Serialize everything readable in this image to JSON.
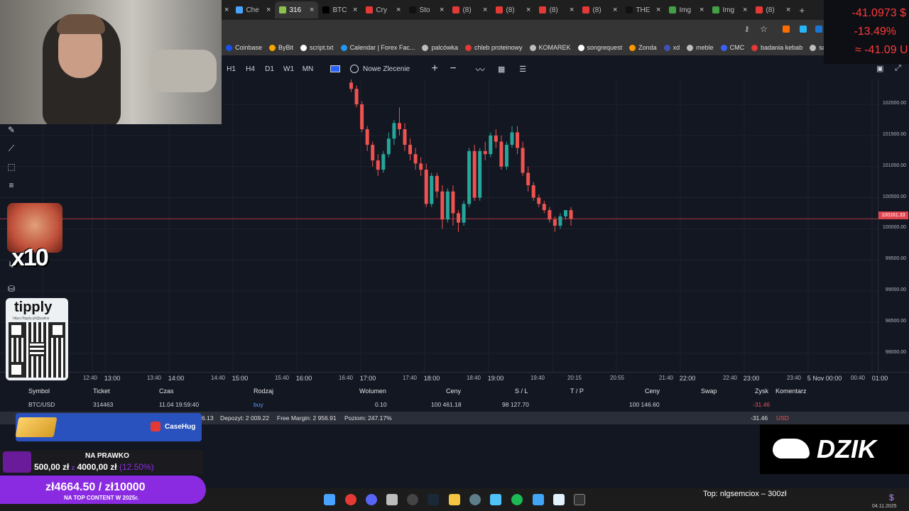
{
  "browser": {
    "tabs": [
      {
        "label": "Che",
        "color": "#4aa3ff",
        "active": false
      },
      {
        "label": "316",
        "color": "#8bc34a",
        "active": true
      },
      {
        "label": "BTC",
        "color": "#000000",
        "active": false
      },
      {
        "label": "Cry",
        "color": "#e53935",
        "active": false
      },
      {
        "label": "Sto",
        "color": "#111111",
        "active": false
      },
      {
        "label": "(8)",
        "color": "#e53935",
        "active": false
      },
      {
        "label": "(8)",
        "color": "#e53935",
        "active": false
      },
      {
        "label": "(8)",
        "color": "#e53935",
        "active": false
      },
      {
        "label": "(8)",
        "color": "#e53935",
        "active": false
      },
      {
        "label": "THE",
        "color": "#111111",
        "active": false
      },
      {
        "label": "Img",
        "color": "#43a047",
        "active": false
      },
      {
        "label": "Img",
        "color": "#43a047",
        "active": false
      },
      {
        "label": "(8)",
        "color": "#e53935",
        "active": false
      }
    ],
    "new_tab": "+",
    "bookmarks": [
      {
        "label": "Coinbase",
        "color": "#1652f0"
      },
      {
        "label": "ByBit",
        "color": "#f7a600"
      },
      {
        "label": "script.txt",
        "color": "#ffffff"
      },
      {
        "label": "Calendar | Forex Fac...",
        "color": "#2196f3"
      },
      {
        "label": "palcówka",
        "color": "#bdbdbd"
      },
      {
        "label": "chleb proteinowy",
        "color": "#e53935"
      },
      {
        "label": "KOMAREK",
        "color": "#bdbdbd"
      },
      {
        "label": "songrequest",
        "color": "#ffffff"
      },
      {
        "label": "Zonda",
        "color": "#ff9800"
      },
      {
        "label": "xd",
        "color": "#3f51b5"
      },
      {
        "label": "meble",
        "color": "#bdbdbd"
      },
      {
        "label": "CMC",
        "color": "#3861fb"
      },
      {
        "label": "badania kebab",
        "color": "#e53935"
      },
      {
        "label": "sauna",
        "color": "#bdbdbd"
      }
    ]
  },
  "toolbar": {
    "timeframes": [
      "H1",
      "H4",
      "D1",
      "W1",
      "MN"
    ],
    "new_order": "Nowe Zlecenie",
    "plus": "+",
    "minus": "−"
  },
  "chart_data": {
    "type": "candlestick",
    "symbol": "BTC/USD",
    "ylim": [
      97700,
      102400
    ],
    "y_ticks": [
      102000,
      101500,
      101000,
      100500,
      100000,
      99500,
      99000,
      98500,
      98000
    ],
    "y_tick_labels": [
      "102000.00",
      "101500.00",
      "101000.00",
      "100500.00",
      "100000.00",
      "99500.00",
      "99000.00",
      "98500.00",
      "98000.00"
    ],
    "current_price": 100161.33,
    "current_price_label": "100161.33",
    "candles": [
      {
        "o": 102350,
        "h": 102420,
        "c": 102250,
        "l": 102200
      },
      {
        "o": 102250,
        "h": 102300,
        "c": 102000,
        "l": 101950
      },
      {
        "o": 102000,
        "h": 102050,
        "c": 101600,
        "l": 101550
      },
      {
        "o": 101600,
        "h": 101650,
        "c": 101350,
        "l": 101250
      },
      {
        "o": 101350,
        "h": 101400,
        "c": 101100,
        "l": 101000
      },
      {
        "o": 101100,
        "h": 101200,
        "c": 100950,
        "l": 100850
      },
      {
        "o": 100950,
        "h": 101250,
        "c": 101200,
        "l": 100900
      },
      {
        "o": 101200,
        "h": 101550,
        "c": 101450,
        "l": 101150
      },
      {
        "o": 101450,
        "h": 101750,
        "c": 101700,
        "l": 101350
      },
      {
        "o": 101700,
        "h": 101950,
        "c": 101600,
        "l": 101500
      },
      {
        "o": 101600,
        "h": 101700,
        "c": 101350,
        "l": 101250
      },
      {
        "o": 101350,
        "h": 101450,
        "c": 101200,
        "l": 101100
      },
      {
        "o": 101200,
        "h": 101300,
        "c": 101050,
        "l": 100950
      },
      {
        "o": 101050,
        "h": 101150,
        "c": 100950,
        "l": 100850
      },
      {
        "o": 100950,
        "h": 101050,
        "c": 100400,
        "l": 100350
      },
      {
        "o": 100400,
        "h": 100900,
        "c": 100850,
        "l": 100350
      },
      {
        "o": 100850,
        "h": 100900,
        "c": 100600,
        "l": 100500
      },
      {
        "o": 100600,
        "h": 100700,
        "c": 100150,
        "l": 100000
      },
      {
        "o": 100150,
        "h": 100650,
        "c": 100600,
        "l": 100100
      },
      {
        "o": 100600,
        "h": 100700,
        "c": 100250,
        "l": 100050
      },
      {
        "o": 100250,
        "h": 100300,
        "c": 100100,
        "l": 99950
      },
      {
        "o": 100100,
        "h": 100450,
        "c": 100400,
        "l": 100050
      },
      {
        "o": 100400,
        "h": 101300,
        "c": 101250,
        "l": 100350
      },
      {
        "o": 101250,
        "h": 101350,
        "c": 100500,
        "l": 100450
      },
      {
        "o": 100500,
        "h": 101300,
        "c": 101250,
        "l": 100450
      },
      {
        "o": 101250,
        "h": 101400,
        "c": 101200,
        "l": 101100
      },
      {
        "o": 101200,
        "h": 101550,
        "c": 101500,
        "l": 101150
      },
      {
        "o": 101500,
        "h": 101600,
        "c": 101400,
        "l": 101300
      },
      {
        "o": 101400,
        "h": 101500,
        "c": 101000,
        "l": 100950
      },
      {
        "o": 101000,
        "h": 101400,
        "c": 101350,
        "l": 100950
      },
      {
        "o": 101350,
        "h": 101650,
        "c": 101550,
        "l": 101300
      },
      {
        "o": 101550,
        "h": 101650,
        "c": 101300,
        "l": 101200
      },
      {
        "o": 101300,
        "h": 101400,
        "c": 100900,
        "l": 100850
      },
      {
        "o": 100900,
        "h": 101000,
        "c": 100700,
        "l": 100600
      },
      {
        "o": 100700,
        "h": 100750,
        "c": 100500,
        "l": 100450
      },
      {
        "o": 100500,
        "h": 100550,
        "c": 100400,
        "l": 100350
      },
      {
        "o": 100400,
        "h": 100450,
        "c": 100300,
        "l": 100250
      },
      {
        "o": 100300,
        "h": 100350,
        "c": 100150,
        "l": 100100
      },
      {
        "o": 100150,
        "h": 100200,
        "c": 100050,
        "l": 99950
      },
      {
        "o": 100050,
        "h": 100250,
        "c": 100200,
        "l": 100000
      },
      {
        "o": 100200,
        "h": 100300,
        "c": 100300,
        "l": 100150
      },
      {
        "o": 100300,
        "h": 100350,
        "c": 100160,
        "l": 100050
      }
    ],
    "x_ticks": [
      {
        "label": "12:40",
        "major": false
      },
      {
        "label": "13:00",
        "major": true
      },
      {
        "label": "13:40",
        "major": false
      },
      {
        "label": "14:00",
        "major": true
      },
      {
        "label": "14:40",
        "major": false
      },
      {
        "label": "15:00",
        "major": true
      },
      {
        "label": "15:40",
        "major": false
      },
      {
        "label": "16:00",
        "major": true
      },
      {
        "label": "16:40",
        "major": false
      },
      {
        "label": "17:00",
        "major": true
      },
      {
        "label": "17:40",
        "major": false
      },
      {
        "label": "18:00",
        "major": true
      },
      {
        "label": "18:40",
        "major": false
      },
      {
        "label": "19:00",
        "major": true
      },
      {
        "label": "19:40",
        "major": false
      },
      {
        "label": "20:15",
        "major": false
      },
      {
        "label": "20:55",
        "major": false
      },
      {
        "label": "21:40",
        "major": false
      },
      {
        "label": "22:00",
        "major": true
      },
      {
        "label": "22:40",
        "major": false
      },
      {
        "label": "23:00",
        "major": true
      },
      {
        "label": "23:40",
        "major": false
      },
      {
        "label": "5 Nov 00:00",
        "major": true
      },
      {
        "label": "00:40",
        "major": false
      },
      {
        "label": "01:00",
        "major": true
      }
    ],
    "colors": {
      "up": "#26a69a",
      "down": "#ef5350",
      "price_line": "#e0444f"
    },
    "grid": true
  },
  "orders": {
    "headers": [
      "Symbol",
      "Ticket",
      "Czas",
      "Rodzaj",
      "Wolumen",
      "Ceny",
      "S / L",
      "T / P",
      "Ceny",
      "Swap",
      "Zysk",
      "Komentarz"
    ],
    "row": {
      "symbol": "BTC/USD",
      "ticket": "314463",
      "time": "11.04 19:59:40",
      "type": "buy",
      "volume": "0.10",
      "open_price": "100 461.18",
      "sl": "98 127.70",
      "tp": "",
      "current_price": "100 146.60",
      "swap": "",
      "profit": "-31.46",
      "comment": ""
    },
    "summary": {
      "balance_partial": "6.13",
      "deposit": "Depozyt: 2 009.22",
      "free_margin": "Free Margin: 2 956.91",
      "level": "Poziom: 247.17%",
      "profit": "-31.46",
      "currency": "USD"
    }
  },
  "overlays": {
    "pnl_lines": [
      "-41.0973 $",
      "-13.49%",
      "≈ -41.09 U"
    ],
    "emote_text": "x10",
    "tipply_title": "tipply",
    "tipply_url": "https://tipply.pl/@patins",
    "casehug": "CaseHug",
    "goal1_title": "NA PRAWKO",
    "goal1_amounts": "500,00 zł",
    "goal1_sep": "z",
    "goal1_target": "4000,00 zł",
    "goal1_pct": "(12.50%)",
    "goal2_amounts": "zł4664.50 / zł10000",
    "goal2_sub": "NA TOP CONTENT W 2025r.",
    "dzik": "DZIK",
    "top_donation": "Top: nlgsemciox –  300zł",
    "clock_date": "04.11.2025"
  }
}
